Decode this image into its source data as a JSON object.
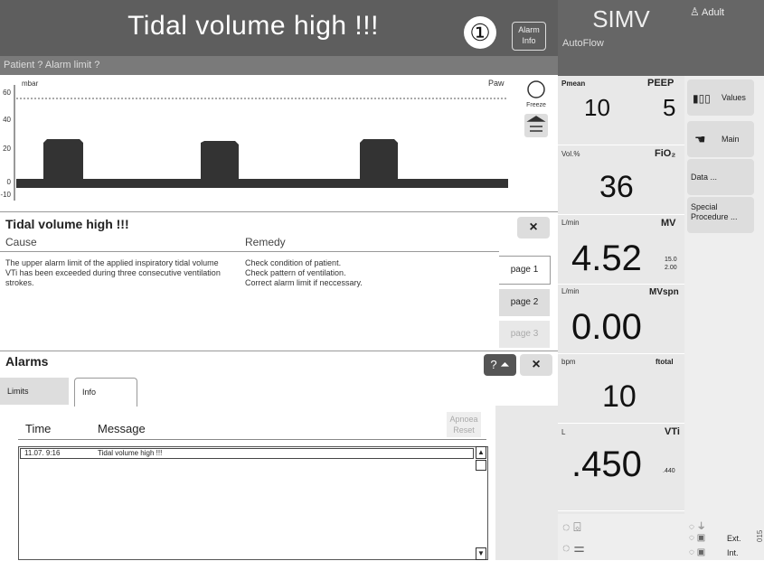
{
  "header": {
    "alarm_title": "Tidal volume high !!!",
    "marker": "①",
    "alarm_info_label_1": "Alarm",
    "alarm_info_label_2": "Info",
    "subtitle": "Patient ? Alarm limit ?",
    "mode": "SIMV",
    "mode_sub": "AutoFlow",
    "patient_type": "Adult"
  },
  "waveform": {
    "unit": "mbar",
    "label": "Paw",
    "y_ticks": [
      "60",
      "40",
      "20",
      "0",
      "-10"
    ],
    "freeze_label": "Freeze"
  },
  "message": {
    "title": "Tidal volume high !!!",
    "close": "×",
    "cause_header": "Cause",
    "remedy_header": "Remedy",
    "cause_text": "The upper alarm limit of the applied inspiratory tidal volume VTi has been exceeded during three consecutive ventilation strokes.",
    "remedy_text": "Check condition of patient.\nCheck pattern of ventilation.\nCorrect alarm limit if neccessary.",
    "pages": [
      "page 1",
      "page 2",
      "page 3"
    ]
  },
  "alarms": {
    "title": "Alarms",
    "help": "? ⏶",
    "close": "×",
    "tabs": [
      "Limits",
      "Info"
    ],
    "col_time": "Time",
    "col_message": "Message",
    "apnoea_1": "Apnoea",
    "apnoea_2": "Reset",
    "rows": [
      {
        "time": "11.07.  9:16",
        "message": "Tidal volume high !!!"
      }
    ]
  },
  "measurements": {
    "pmean": {
      "label": "Pmean",
      "value": "10"
    },
    "peep": {
      "label": "PEEP",
      "value": "5"
    },
    "fio2": {
      "unit": "Vol.%",
      "label": "FiO₂",
      "value": "36"
    },
    "mv": {
      "unit": "L/min",
      "label": "MV",
      "value": "4.52",
      "limit_hi": "15.0",
      "limit_lo": "2.00"
    },
    "mvspn": {
      "unit": "L/min",
      "label": "MVspn",
      "value": "0.00"
    },
    "ftotal": {
      "unit": "bpm",
      "label": "ftotal",
      "value": "10"
    },
    "vti": {
      "unit": "L",
      "label": "VTi",
      "value": ".450",
      "limit": ".440"
    }
  },
  "side_buttons": {
    "values": "Values",
    "main": "Main",
    "data": "Data ...",
    "special": "Special Procedure ..."
  },
  "footer": {
    "ext": "Ext.",
    "int": "Int."
  },
  "doc_id": "015"
}
